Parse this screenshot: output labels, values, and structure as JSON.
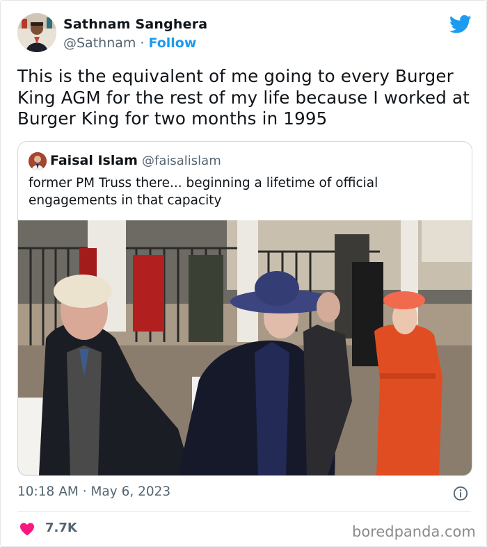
{
  "author": {
    "name": "Sathnam Sanghera",
    "handle": "@Sathnam",
    "separator": " · ",
    "follow_label": "Follow"
  },
  "tweet": {
    "text": "This is the equivalent of me going to every Burger King AGM for the rest of my life because I worked at Burger King for two months in 1995",
    "timestamp": "10:18 AM · May 6, 2023",
    "likes": "7.7K"
  },
  "quoted": {
    "name": "Faisal Islam",
    "handle": "@faisalislam",
    "text": "former PM Truss there... beginning a lifetime of official engagements in that capacity"
  },
  "watermark": "boredpanda.com",
  "icons": {
    "brand": "twitter-bird-icon",
    "info": "info-icon",
    "like": "heart-icon"
  },
  "colors": {
    "twitter_blue": "#1d9bf0",
    "like_red": "#f91880",
    "text_primary": "#0f1419",
    "text_secondary": "#536471"
  }
}
